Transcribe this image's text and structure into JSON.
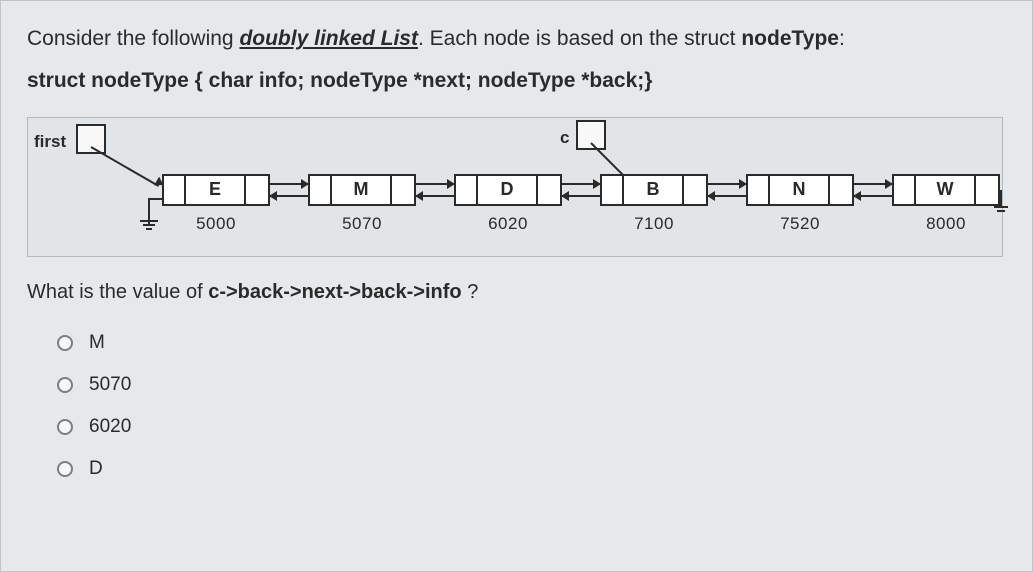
{
  "intro": {
    "prefix": "Consider the following ",
    "emph": "doubly linked List",
    "mid": ". Each node is based on the struct ",
    "type": "nodeType",
    "suffix": ":"
  },
  "struct_decl": "struct nodeType { char info; nodeType *next; nodeType *back;}",
  "diagram": {
    "first_label": "first",
    "c_label": "c",
    "nodes": [
      {
        "info": "E",
        "addr": "5000"
      },
      {
        "info": "M",
        "addr": "5070"
      },
      {
        "info": "D",
        "addr": "6020"
      },
      {
        "info": "B",
        "addr": "7100"
      },
      {
        "info": "N",
        "addr": "7520"
      },
      {
        "info": "W",
        "addr": "8000"
      }
    ]
  },
  "question": {
    "prefix": "What is the value of ",
    "expr": "c->back->next->back->info",
    "suffix": " ?"
  },
  "options": [
    "M",
    "5070",
    "6020",
    "D"
  ]
}
